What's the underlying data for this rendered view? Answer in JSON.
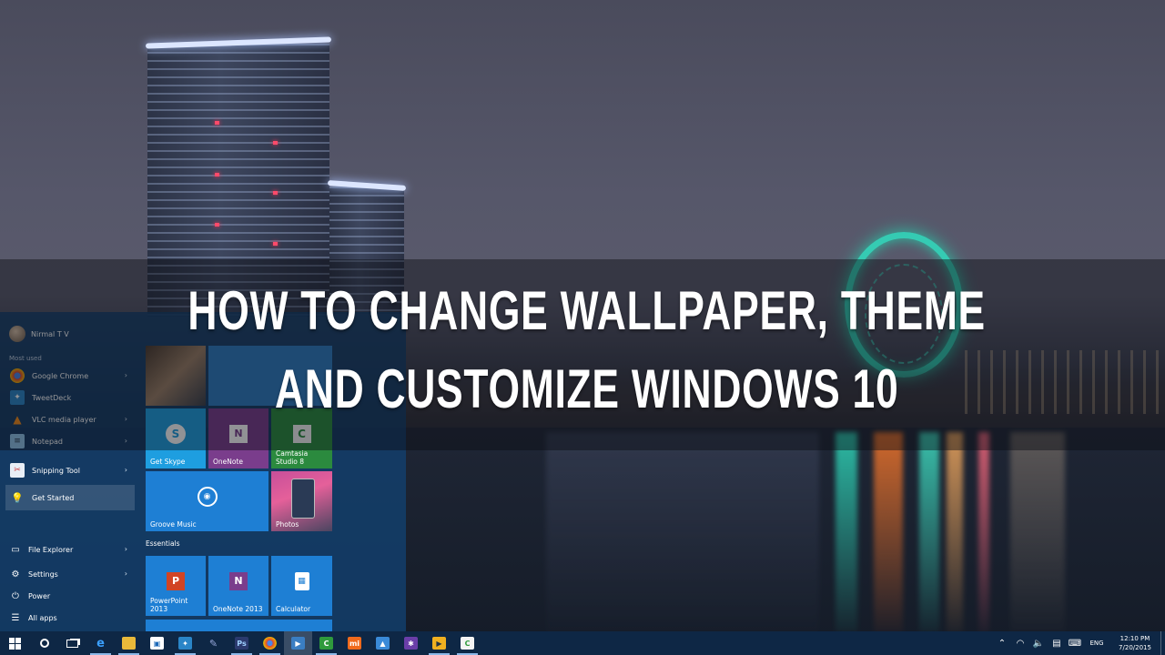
{
  "video_title": {
    "line1": "HOW TO CHANGE WALLPAPER, THEME",
    "line2": "AND CUSTOMIZE WINDOWS 10"
  },
  "start_menu": {
    "user_name": "Nirmal T V",
    "most_used_label": "Most used",
    "apps": [
      {
        "label": "Google Chrome"
      },
      {
        "label": "TweetDeck"
      },
      {
        "label": "VLC media player"
      },
      {
        "label": "Notepad"
      },
      {
        "label": "Snipping Tool"
      },
      {
        "label": "Get Started"
      }
    ],
    "system_items": [
      {
        "label": "File Explorer",
        "icon": "folder-icon"
      },
      {
        "label": "Settings",
        "icon": "gear-icon"
      },
      {
        "label": "Power",
        "icon": "power-icon"
      },
      {
        "label": "All apps",
        "icon": "list-icon"
      }
    ],
    "tiles_top": [
      {
        "label": "Get Skype"
      },
      {
        "label": "OneNote"
      },
      {
        "label": "Camtasia Studio 8"
      },
      {
        "label": "Groove Music"
      },
      {
        "label": "Photos"
      }
    ],
    "essentials_label": "Essentials",
    "tiles_essentials": [
      {
        "label": "PowerPoint 2013"
      },
      {
        "label": "OneNote 2013"
      },
      {
        "label": "Calculator"
      }
    ]
  },
  "taskbar": {
    "language": "ENG",
    "time": "12:10 PM",
    "date": "7/20/2015",
    "pinned": [
      {
        "name": "edge-icon",
        "color": "#1e7fd4",
        "glyph": "e"
      },
      {
        "name": "file-explorer-icon",
        "color": "#e9b93a",
        "glyph": ""
      },
      {
        "name": "store-icon",
        "color": "#ffffff",
        "glyph": ""
      },
      {
        "name": "tweetdeck-icon",
        "color": "#2a85c7",
        "glyph": ""
      },
      {
        "name": "paint-icon",
        "color": "#2c6ca8",
        "glyph": ""
      },
      {
        "name": "photoshop-icon",
        "color": "#2b3a6e",
        "glyph": "Ps"
      },
      {
        "name": "chrome-icon",
        "color": "#dd4b39",
        "glyph": ""
      },
      {
        "name": "media-app-icon",
        "color": "#3a7ec2",
        "glyph": ""
      },
      {
        "name": "camtasia-icon",
        "color": "#2f9a3c",
        "glyph": "C"
      },
      {
        "name": "mi-icon",
        "color": "#f06a1c",
        "glyph": "mi"
      },
      {
        "name": "photo-viewer-icon",
        "color": "#3a8ad8",
        "glyph": ""
      },
      {
        "name": "settings-app-icon",
        "color": "#6a3ea8",
        "glyph": "✱"
      },
      {
        "name": "player-icon",
        "color": "#f0b020",
        "glyph": "▶"
      },
      {
        "name": "camtasia-recorder-icon",
        "color": "#f4f4f4",
        "glyph": "C"
      }
    ]
  },
  "colors": {
    "accent": "#2a8cd0",
    "start_menu_bg": "#123f6e",
    "taskbar_bg": "#0e2848"
  }
}
